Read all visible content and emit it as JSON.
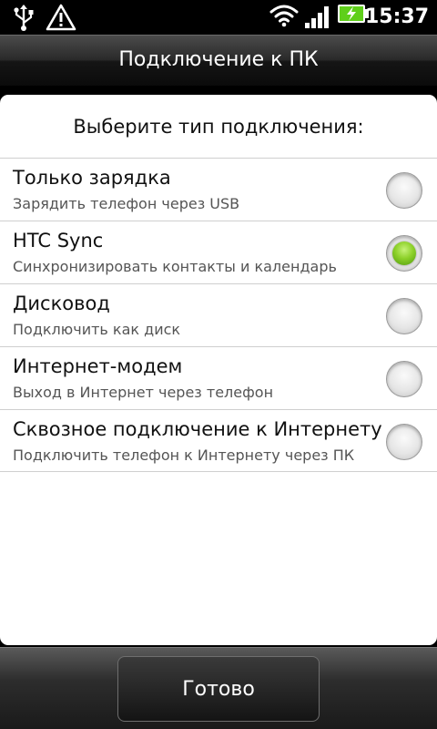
{
  "status_bar": {
    "time": "15:37",
    "icons": [
      "usb-icon",
      "warning-icon",
      "wifi-icon",
      "signal-icon",
      "battery-charging-icon"
    ]
  },
  "header": {
    "title": "Подключение к ПК"
  },
  "dialog": {
    "heading": "Выберите тип подключения:",
    "options": [
      {
        "title": "Только зарядка",
        "subtitle": "Зарядить телефон через USB",
        "selected": false
      },
      {
        "title": "HTC Sync",
        "subtitle": "Синхронизировать контакты и календарь",
        "selected": true
      },
      {
        "title": "Дисковод",
        "subtitle": "Подключить как диск",
        "selected": false
      },
      {
        "title": "Интернет-модем",
        "subtitle": "Выход в Интернет через телефон",
        "selected": false
      },
      {
        "title": "Сквозное подключение к Интернету",
        "subtitle": "Подключить телефон к Интернету через ПК",
        "selected": false
      }
    ]
  },
  "footer": {
    "done_label": "Готово"
  },
  "colors": {
    "radio_selected": "#8dd12a",
    "battery_fill": "#5fcf1a"
  }
}
